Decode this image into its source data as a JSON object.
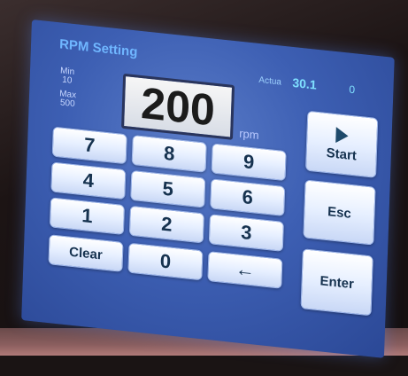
{
  "screen": {
    "title": "RPM Setting",
    "actual_label": "Actua",
    "actual_value": "30.1",
    "actual_speed": "0",
    "min_label": "Min",
    "min_value": "10",
    "max_label": "Max",
    "max_value": "500",
    "display_value": "200",
    "unit": "rpm"
  },
  "keypad": {
    "keys": [
      "7",
      "8",
      "9",
      "4",
      "5",
      "6",
      "1",
      "2",
      "3",
      "0"
    ],
    "clear_label": "Clear",
    "backspace_icon": "←"
  },
  "side_buttons": {
    "start_label": "Start",
    "start_icon": "play-icon",
    "esc_label": "Esc",
    "enter_label": "Enter"
  },
  "colors": {
    "screen_blue": "#3d5fb3",
    "title_blue": "#6fb6ff",
    "key_text": "#16324f"
  }
}
